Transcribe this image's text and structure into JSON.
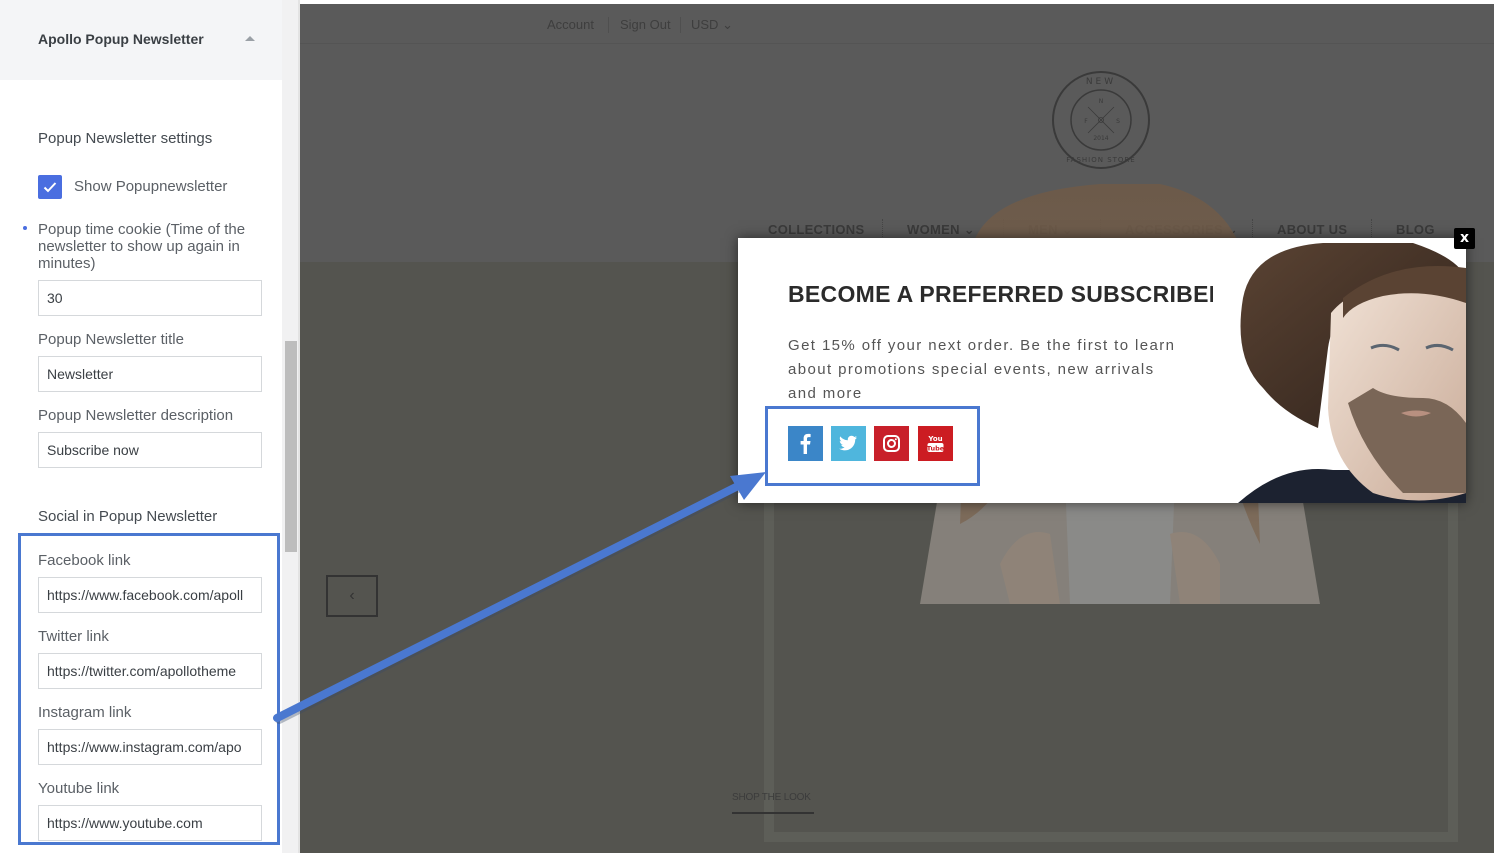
{
  "sidebar": {
    "header_title": "Apollo Popup Newsletter",
    "settings_heading": "Popup Newsletter settings",
    "show_checkbox": {
      "label": "Show Popupnewsletter",
      "checked": true
    },
    "cookie_label": "Popup time cookie (Time of the newsletter to show up again in minutes)",
    "cookie_value": "30",
    "title_label": "Popup Newsletter title",
    "title_value": "Newsletter",
    "description_label": "Popup Newsletter description",
    "description_value": "Subscribe now",
    "social_heading": "Social in Popup Newsletter",
    "social_fields": [
      {
        "label": "Facebook link",
        "value": "https://www.facebook.com/apoll"
      },
      {
        "label": "Twitter link",
        "value": "https://twitter.com/apollotheme"
      },
      {
        "label": "Instagram link",
        "value": "https://www.instagram.com/apo"
      },
      {
        "label": "Youtube link",
        "value": "https://www.youtube.com"
      }
    ]
  },
  "store": {
    "topbar": {
      "account": "Account",
      "sign_out": "Sign Out",
      "currency": "USD",
      "currency_caret": "⌄"
    },
    "logo": {
      "top": "NEW",
      "letters": [
        "N",
        "F",
        "S"
      ],
      "year": "2014",
      "bottom": "FASHION STORE"
    },
    "nav": [
      {
        "label": "COLLECTIONS",
        "caret": ""
      },
      {
        "label": "WOMEN",
        "caret": "⌄"
      },
      {
        "label": "MEN",
        "caret": "⌄"
      },
      {
        "label": "ACCESSORIES",
        "caret": "⌄"
      },
      {
        "label": "ABOUT US",
        "caret": ""
      },
      {
        "label": "BLOG",
        "caret": ""
      }
    ],
    "prev_arrow": "‹",
    "shop_the_look": "SHOP THE LOOK"
  },
  "popup": {
    "title": "BECOME A PREFERRED SUBSCRIBER",
    "description": "Get 15% off your next order. Be the first to learn about promotions special events, new arrivals and more",
    "close_label": "x",
    "social": [
      {
        "name": "facebook",
        "color": "#3b86c8"
      },
      {
        "name": "twitter",
        "color": "#4fb6dd"
      },
      {
        "name": "instagram",
        "color": "#c8202a"
      },
      {
        "name": "youtube",
        "color": "#cc1c22"
      }
    ]
  },
  "colors": {
    "accent": "#4a6ee0",
    "annotation": "#4a78d0",
    "overlay": "#5a5a5a"
  }
}
